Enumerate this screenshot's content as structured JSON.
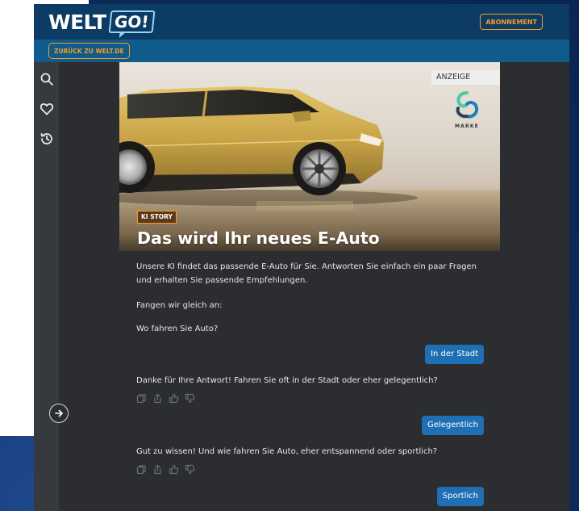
{
  "header": {
    "logo_main": "WELT",
    "logo_accent": "GO!",
    "subscription_label": "ABONNEMENT",
    "back_label": "ZURÜCK ZU WELT.DE"
  },
  "sidebar": {
    "icons": [
      "search-icon",
      "heart-icon",
      "history-icon"
    ],
    "collapse_icon": "arrow-right-icon"
  },
  "hero": {
    "ad_label": "ANZEIGE",
    "brand_name": "MARKE",
    "badge": "KI STORY",
    "title": "Das wird Ihr neues E-Auto"
  },
  "chat": {
    "intro": "Unsere KI findet das passende E-Auto für Sie. Antworten Sie einfach ein paar Fragen und erhalten Sie passende Empfehlungen.",
    "start": "Fangen wir gleich an:",
    "question_1": "Wo fahren Sie Auto?",
    "answer_1": "In der Stadt",
    "question_2": "Danke für Ihre Antwort! Fahren Sie oft in der Stadt oder eher gelegentlich?",
    "answer_2": "Gelegentlich",
    "question_3": "Gut zu wissen! Und wie fahren Sie Auto, eher entspannend oder sportlich?",
    "answer_3": "Sportlich",
    "action_icons": [
      "copy-icon",
      "share-icon",
      "thumbs-up-icon",
      "thumbs-down-icon"
    ]
  },
  "colors": {
    "header_bg": "#0c3b64",
    "subheader_bg": "#0f5b8c",
    "accent_orange": "#f39c2a",
    "chip_blue": "#1f6fb5",
    "app_bg": "#2b2d30"
  }
}
